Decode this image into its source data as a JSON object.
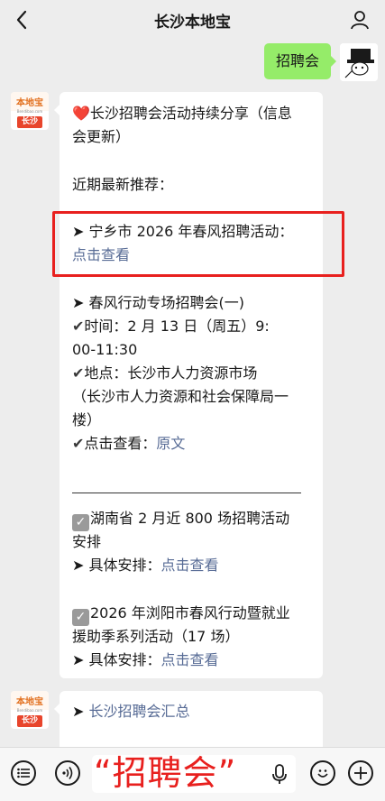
{
  "header": {
    "title": "长沙本地宝"
  },
  "outgoing": {
    "text": "招聘会"
  },
  "account": {
    "logo_text": "本地宝",
    "logo_sub": "Bendibao.com",
    "logo_city": "长沙"
  },
  "message1": {
    "heart": "❤️",
    "title": "长沙招聘会活动持续分享（信息会更新）",
    "title_line1": "长沙招聘会活动持续分享（信息",
    "title_line2": "会更新）",
    "recent": "近期最新推荐：",
    "item1_prefix": "➤ 宁乡市 2026 年春风招聘活动：",
    "item1_link": "点击查看",
    "item2_title": "➤ 春风行动专场招聘会(一)",
    "item2_time_label": "时间：2 月 13 日（周五）9:",
    "item2_time_cont": "00-11:30",
    "item2_place_line1": "地点：长沙市人力资源市场",
    "item2_place_line2": "（长沙市人力资源和社会保障局一",
    "item2_place_line3": "楼）",
    "item2_view_label": "点击查看：",
    "item2_view_link": "原文",
    "item3_line1": "湖南省 2 月近 800 场招聘活动",
    "item3_line2": "安排",
    "item3_arrange_label": "➤ 具体安排：",
    "item3_arrange_link": "点击查看",
    "item4_line1": "2026 年浏阳市春风行动暨就业",
    "item4_line2": "援助季系列活动（17 场）",
    "item4_arrange_label": "➤ 具体安排：",
    "item4_arrange_link": "点击查看",
    "check_glyph": "✔",
    "box_glyph": "✓"
  },
  "message2": {
    "prefix": "➤ ",
    "link": "长沙招聘会汇总"
  },
  "overlay_caption": "“招聘会”",
  "colors": {
    "link": "#576b95",
    "highlight": "#e8201e",
    "outgoing_bubble": "#95ec69"
  },
  "icons": [
    "back-icon",
    "user-icon",
    "list-icon",
    "voice-icon",
    "mic-icon",
    "emoji-icon",
    "plus-icon"
  ]
}
